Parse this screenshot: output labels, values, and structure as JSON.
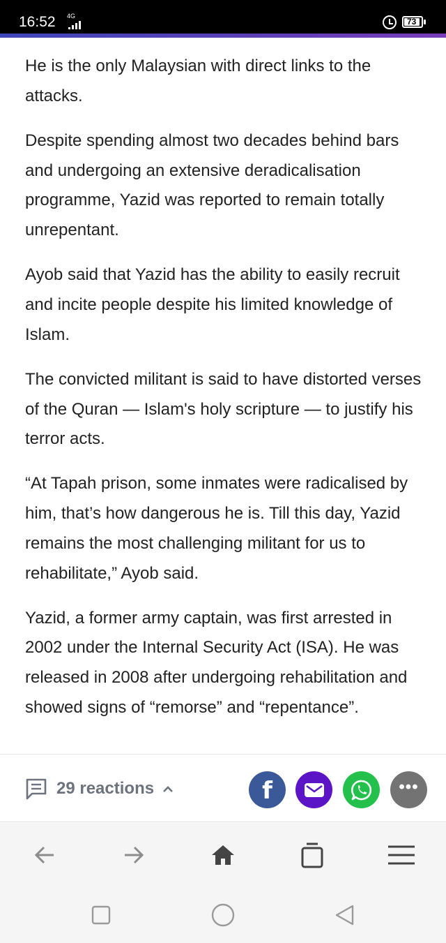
{
  "status_bar": {
    "time": "16:52",
    "network": "4G",
    "battery": "73"
  },
  "article": {
    "paragraphs": [
      "He is the only Malaysian with direct links to the attacks.",
      "Despite spending almost two decades behind bars and undergoing an extensive deradicalisation programme, Yazid was reported to remain totally unrepentant.",
      "Ayob said that Yazid has the ability to easily recruit and incite people despite his limited knowledge of Islam.",
      "The convicted militant is said to have distorted verses of the Quran — Islam's holy scripture — to justify his terror acts.",
      "“At Tapah prison, some inmates were radicalised by him, that’s how dangerous he is. Till this day, Yazid remains the most challenging militant for us to rehabilitate,” Ayob said.",
      "Yazid, a former army captain, was first arrested in 2002 under the Internal Security Act (ISA). He was released in 2008 after undergoing rehabilitation and showed signs of “remorse” and “repentance”."
    ]
  },
  "reactions": {
    "label": "29 reactions",
    "icon": "comment-icon"
  },
  "share": {
    "facebook_glyph": "f",
    "more_glyph": "•••",
    "colors": {
      "facebook": "#3b5998",
      "email": "#5c14c7",
      "whatsapp": "#23c14c",
      "more": "#737373"
    }
  },
  "toolbar": {
    "icons": [
      "back-arrow-icon",
      "forward-arrow-icon",
      "home-icon",
      "tabs-icon",
      "menu-icon"
    ]
  },
  "nav_bar": {
    "icons": [
      "recent-apps-icon",
      "home-circle-icon",
      "back-triangle-icon"
    ]
  },
  "colors": {
    "progress_start": "#3f46b8",
    "progress_end": "#7a3cb8",
    "text": "#222222",
    "reactions_text": "#6d737d"
  }
}
